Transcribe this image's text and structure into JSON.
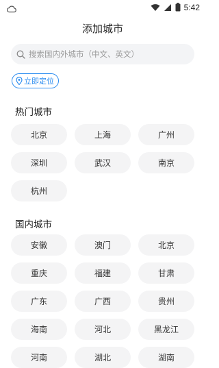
{
  "status_bar": {
    "time": "5:42",
    "icons": [
      "cloud-icon",
      "wifi-icon",
      "signal-icon",
      "battery-icon"
    ]
  },
  "header": {
    "title": "添加城市"
  },
  "search": {
    "placeholder": "搜索国内外城市（中文、英文）"
  },
  "locate": {
    "label": "立即定位"
  },
  "hot_cities": {
    "title": "热门城市",
    "items": [
      "北京",
      "上海",
      "广州",
      "深圳",
      "武汉",
      "南京",
      "杭州"
    ]
  },
  "domestic_cities": {
    "title": "国内城市",
    "items": [
      "安徽",
      "澳门",
      "北京",
      "重庆",
      "福建",
      "甘肃",
      "广东",
      "广西",
      "贵州",
      "海南",
      "河北",
      "黑龙江",
      "河南",
      "湖北",
      "湖南"
    ]
  },
  "colors": {
    "accent": "#2a8cf0",
    "chip_bg": "#f4f4f5",
    "search_bg": "#f3f4f6"
  }
}
